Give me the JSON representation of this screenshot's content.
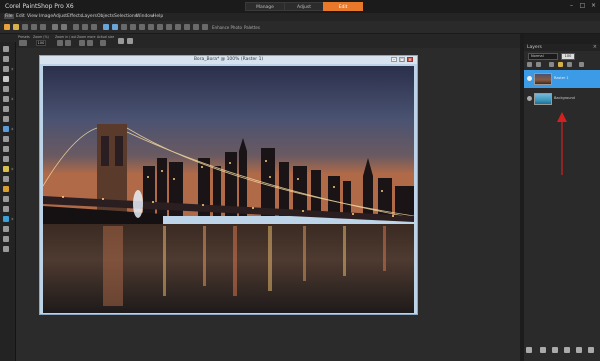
{
  "app": {
    "title": "Corel PaintShop Pro X6",
    "tabs": [
      {
        "label": "Manage",
        "active": false
      },
      {
        "label": "Adjust",
        "active": false
      },
      {
        "label": "Edit",
        "active": true
      }
    ],
    "accent_color": "#e8782a"
  },
  "menu": [
    "File",
    "Edit",
    "View",
    "Image",
    "Adjust",
    "Effects",
    "Layers",
    "Objects",
    "Selections",
    "Window",
    "Help"
  ],
  "toolbar": {
    "enhance_photo_label": "Enhance Photo",
    "palettes_label": "Palettes"
  },
  "options_bar": {
    "labels": [
      "Presets",
      "Zoom (%)",
      "Zoom in / out",
      "Zoom more",
      "Actual size"
    ],
    "zoom_value": "100"
  },
  "document": {
    "title": "Bora_Bora* @ 100% (Raster 1)"
  },
  "layers_panel": {
    "title": "Layers",
    "blend_mode": "Normal",
    "opacity": "100",
    "layers": [
      {
        "name": "Raster 1",
        "selected": true
      },
      {
        "name": "Background",
        "selected": false
      }
    ],
    "selected_color": "#3c9be6"
  },
  "annotation": {
    "arrow_color": "#d42020"
  }
}
